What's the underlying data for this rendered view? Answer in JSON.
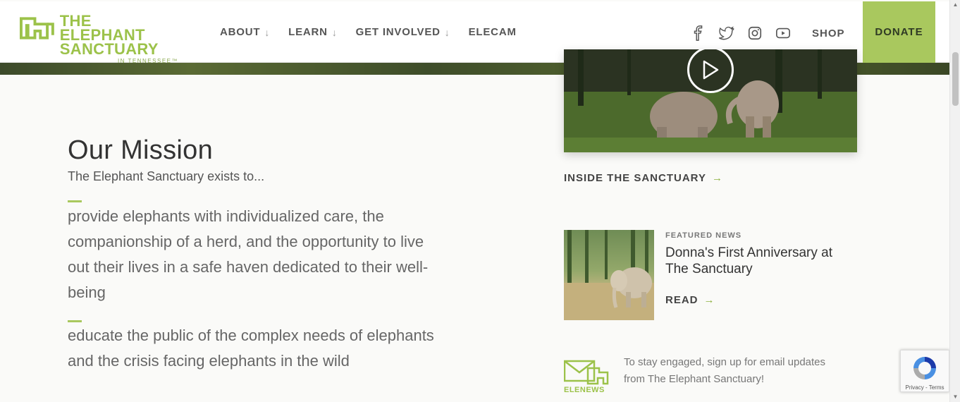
{
  "header": {
    "logo": {
      "line1": "THE ELEPHANT",
      "line2": "SANCTUARY",
      "line3": "IN TENNESSEE™"
    },
    "nav": [
      {
        "label": "ABOUT",
        "has_dropdown": true
      },
      {
        "label": "LEARN",
        "has_dropdown": true
      },
      {
        "label": "GET INVOLVED",
        "has_dropdown": true
      },
      {
        "label": "ELECAM",
        "has_dropdown": false
      }
    ],
    "social_icons": [
      "facebook-icon",
      "twitter-icon",
      "instagram-icon",
      "youtube-icon"
    ],
    "shop_label": "SHOP",
    "donate_label": "DONATE"
  },
  "mission": {
    "title": "Our Mission",
    "subtitle": "The Elephant Sanctuary exists to...",
    "points": [
      "provide elephants with individualized care, the companionship of a herd, and the opportunity to live out their lives in a safe haven dedicated to their well-being",
      "educate the public of the complex needs of elephants and the crisis facing elephants in the wild"
    ]
  },
  "video": {
    "cta_label": "INSIDE THE SANCTUARY"
  },
  "news": {
    "kicker": "FEATURED NEWS",
    "title": "Donna's First Anniversary at The Sanctuary",
    "read_label": "READ"
  },
  "elenews": {
    "label": "ELENEWS",
    "text": "To stay engaged, sign up for email updates from The Elephant Sanctuary!"
  },
  "recaptcha": {
    "text": "Privacy - Terms"
  },
  "colors": {
    "accent": "#a9c85e",
    "logo_green": "#9cc24a",
    "text_dark": "#333333"
  }
}
